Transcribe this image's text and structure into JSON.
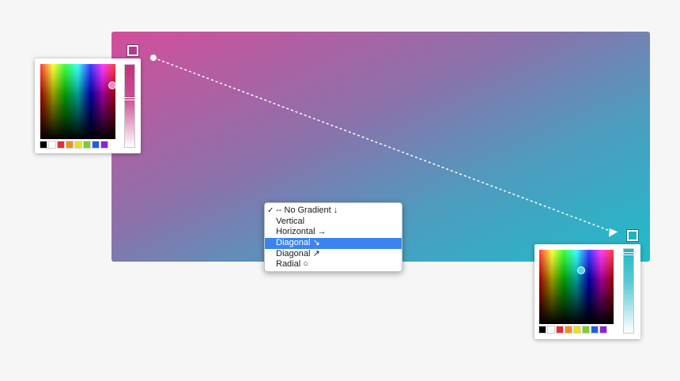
{
  "gradient": {
    "start_color": "#d44e9b",
    "end_color": "#1ebcca",
    "start_stop_color": "#b8398c",
    "end_stop_color": "#1db4c4"
  },
  "pickers": {
    "start": {
      "hue_handle_color": "#ff7ac0",
      "palette": [
        "#000000",
        "#ffffff",
        "#e03030",
        "#f09020",
        "#e8e020",
        "#80cc30",
        "#2060e0",
        "#9020e0"
      ]
    },
    "end": {
      "hue_handle_color": "#30d8e8",
      "palette": [
        "#000000",
        "#ffffff",
        "#e03030",
        "#f09020",
        "#e8e020",
        "#80cc30",
        "#2060e0",
        "#9020e0"
      ]
    }
  },
  "menu": {
    "checked_index": 0,
    "selected_index": 3,
    "items": [
      {
        "label": "-- No Gradient ↓"
      },
      {
        "label": "Vertical"
      },
      {
        "label": "Horizontal →"
      },
      {
        "label": "Diagonal ↘"
      },
      {
        "label": "Diagonal ↗"
      },
      {
        "label": "Radial ○"
      }
    ],
    "check_glyph": "✓"
  }
}
